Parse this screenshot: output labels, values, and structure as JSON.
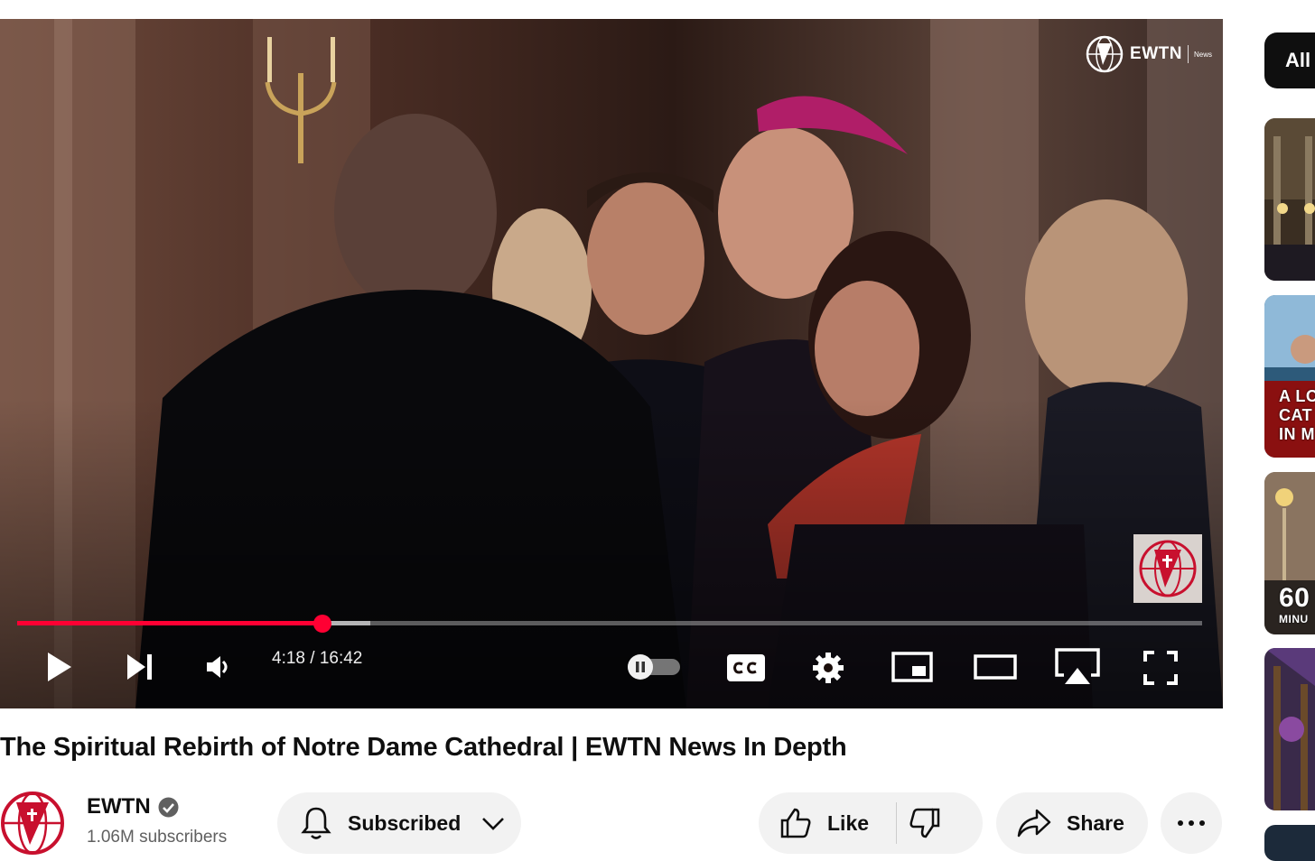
{
  "player": {
    "watermark": {
      "name": "EWTN",
      "sub": "News"
    },
    "progress": {
      "played_fraction": 0.2577,
      "buffered_fraction": 0.2982
    },
    "time": {
      "current": "4:18",
      "separator": " / ",
      "duration": "16:42"
    },
    "autoplay_on": false,
    "icons": [
      "play-icon",
      "next-icon",
      "volume-icon",
      "autoplay-toggle",
      "captions-icon",
      "settings-icon",
      "miniplayer-icon",
      "theater-icon",
      "airplay-icon",
      "fullscreen-icon"
    ]
  },
  "video": {
    "title": "The Spiritual Rebirth of Notre Dame Cathedral | EWTN News In Depth"
  },
  "channel": {
    "name": "EWTN",
    "subscribers": "1.06M subscribers",
    "verified": true
  },
  "actions": {
    "subscribed_label": "Subscribed",
    "like_label": "Like",
    "share_label": "Share"
  },
  "sidebar": {
    "chip_label": "All",
    "thumbnails": [
      {
        "text": ""
      },
      {
        "text_lines": [
          "A LO",
          "CAT",
          "IN M"
        ]
      },
      {
        "text_lines": [
          "60",
          "MINU"
        ]
      },
      {
        "text": ""
      }
    ]
  },
  "colors": {
    "accent_red": "#ff0033",
    "pill_bg": "#f2f2f2",
    "text_primary": "#0f0f0f",
    "text_secondary": "#606060",
    "logo_red": "#c8102e"
  }
}
